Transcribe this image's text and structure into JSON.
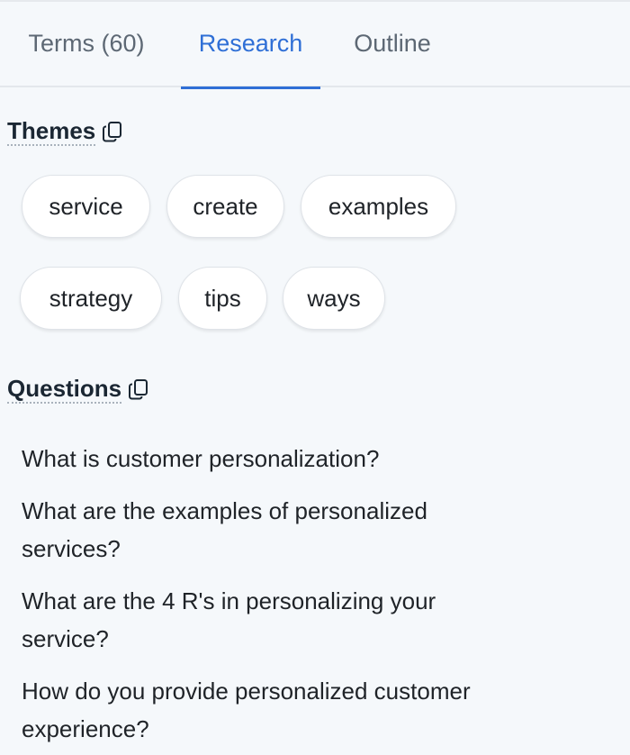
{
  "tabs": [
    {
      "label": "Terms (60)",
      "active": false
    },
    {
      "label": "Research",
      "active": true
    },
    {
      "label": "Outline",
      "active": false
    }
  ],
  "themes": {
    "title": "Themes",
    "chips": [
      "service",
      "create",
      "examples",
      "strategy",
      "tips",
      "ways"
    ]
  },
  "questions": {
    "title": "Questions",
    "items": [
      "What is customer personalization?",
      "What are the examples of personalized services?",
      "What are the 4 R's in personalizing your service?",
      "How do you provide personalized customer experience?"
    ]
  },
  "colors": {
    "accent": "#2f6fd6",
    "background": "#f5f8fb",
    "chip_background": "#ffffff",
    "muted_text": "#5d6874"
  },
  "icons": {
    "copy": "copy-icon"
  }
}
